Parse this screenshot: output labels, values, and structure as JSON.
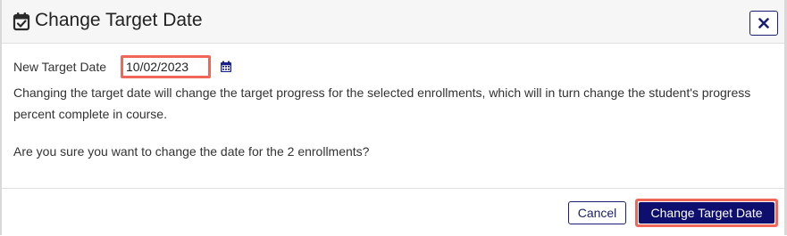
{
  "dialog": {
    "title": "Change Target Date",
    "title_icon": "calendar-check-icon",
    "close_icon": "close-icon"
  },
  "form": {
    "label": "New Target Date",
    "date_value": "10/02/2023",
    "calendar_icon": "calendar-icon"
  },
  "message": {
    "line1": "Changing the target date will change the target progress for the selected enrollments, which will in turn change the student's progress percent complete in course.",
    "line2": "Are you sure you want to change the date for the 2 enrollments?"
  },
  "buttons": {
    "cancel": "Cancel",
    "confirm": "Change Target Date"
  },
  "colors": {
    "primary": "#0e0e6e",
    "highlight": "#f0675a",
    "header_bg": "#f6f6f6"
  }
}
